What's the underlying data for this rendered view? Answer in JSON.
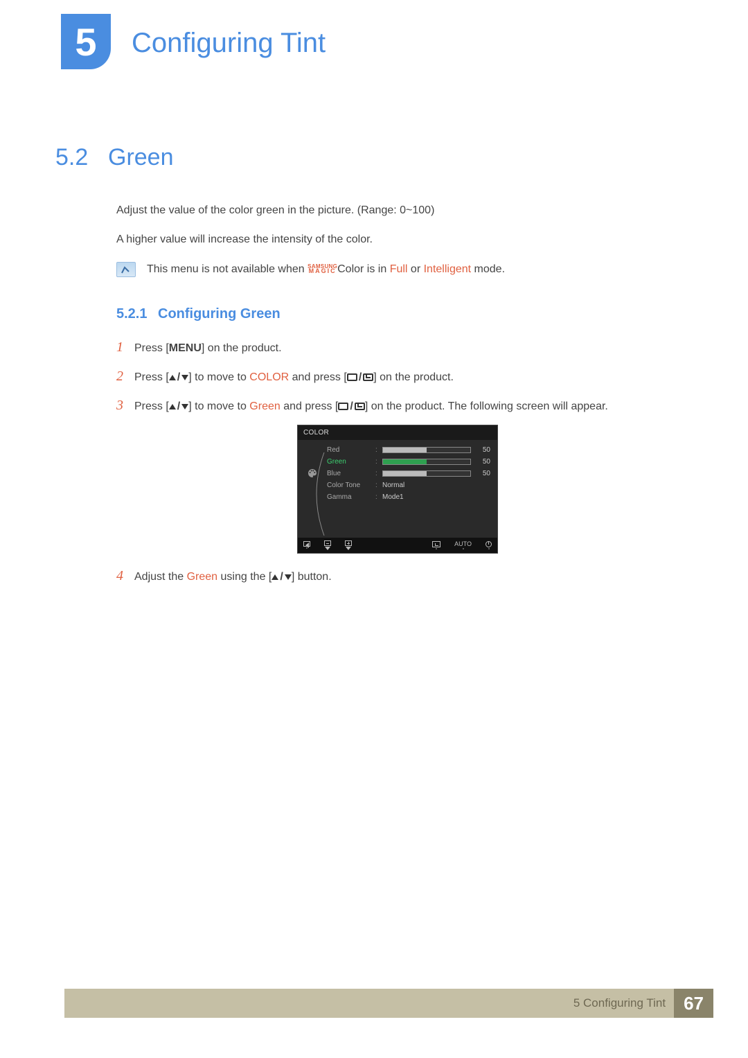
{
  "chapter": {
    "number": "5",
    "title": "Configuring Tint"
  },
  "section": {
    "number": "5.2",
    "title": "Green"
  },
  "intro": {
    "p1": "Adjust the value of the color green in the picture. (Range: 0~100)",
    "p2": "A higher value will increase the intensity of the color."
  },
  "note": {
    "pre": "This menu is not available when ",
    "brand_top": "SAMSUNG",
    "brand_bot": "MAGIC",
    "color_word": "Color",
    "mid": " is in ",
    "full": "Full",
    "or": " or ",
    "intelligent": "Intelligent",
    "post": " mode."
  },
  "subsection": {
    "number": "5.2.1",
    "title": "Configuring Green"
  },
  "steps": {
    "s1": {
      "num": "1",
      "pre": "Press [",
      "menu": "MENU",
      "post": "] on the product."
    },
    "s2": {
      "num": "2",
      "pre": "Press [",
      "mid1": "] to move to ",
      "target": "COLOR",
      "mid2": " and press [",
      "post": "] on the product."
    },
    "s3": {
      "num": "3",
      "pre": "Press [",
      "mid1": "] to move to ",
      "target": "Green",
      "mid2": " and press [",
      "post": "] on the product. The following screen will appear."
    },
    "s4": {
      "num": "4",
      "pre": "Adjust the ",
      "target": "Green",
      "mid": " using the [",
      "post": "] button."
    }
  },
  "osd": {
    "title": "COLOR",
    "rows": [
      {
        "label": "Red",
        "type": "bar",
        "value": 50
      },
      {
        "label": "Green",
        "type": "bar",
        "value": 50,
        "selected": true
      },
      {
        "label": "Blue",
        "type": "bar",
        "value": 50
      },
      {
        "label": "Color Tone",
        "type": "text",
        "text": "Normal"
      },
      {
        "label": "Gamma",
        "type": "text",
        "text": "Mode1"
      }
    ],
    "footer_auto": "AUTO"
  },
  "footer": {
    "label": "5 Configuring Tint",
    "page": "67"
  }
}
